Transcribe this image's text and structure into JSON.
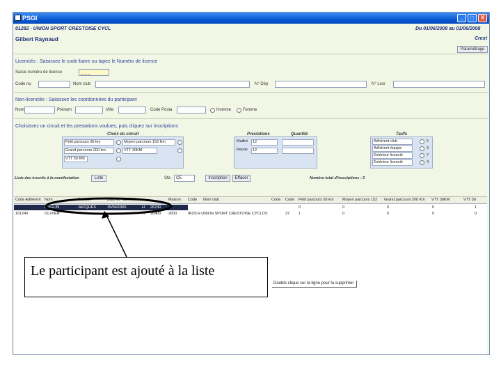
{
  "window": {
    "title": "PSGI",
    "controls": {
      "minimize": "_",
      "maximize": "□",
      "close": "X"
    }
  },
  "header": {
    "club": "01282 - UNION SPORT CRESTOISE CYCL",
    "person": "Gilbert Raynaud",
    "period": "Du 01/06/2008 au 01/06/2008",
    "place": "Crest",
    "settings_button": "Paramétrage"
  },
  "licencies": {
    "section_title": "Licenciés : Saisissez le code-barre ou tapez le Numéro de licence",
    "barcode_label": "Saisie numéro de licence",
    "barcode_value": "_ _ _",
    "fields": [
      {
        "label": "Code nu",
        "value": ""
      },
      {
        "label": "Nom club",
        "value": ""
      },
      {
        "label": "N° Dép",
        "value": ""
      },
      {
        "label": "N° Lice",
        "value": ""
      }
    ]
  },
  "non_licencies": {
    "section_title": "Non-licenciés : Saisissez les coordonnées du participant",
    "fields": [
      {
        "label": "Nom",
        "value": ""
      },
      {
        "label": "Prénom",
        "value": ""
      },
      {
        "label": "Ville",
        "value": ""
      },
      {
        "label": "Code Posta",
        "value": ""
      }
    ],
    "gender": {
      "male": "Homme",
      "female": "Femme"
    }
  },
  "circuit": {
    "section_title": "Choisissez un circuit et les prestations voulues, puis cliquez sur inscriptions",
    "col_circuit": "Choix du circuit",
    "col_prestations": "Prestations",
    "col_quantite": "Quantité",
    "col_tarifs": "Tarifs",
    "circuits": [
      {
        "label": "Petit parcours 95 km",
        "value": ""
      },
      {
        "label": "Grand parcours 200 km",
        "value": ""
      },
      {
        "label": "VTT 50 KM",
        "value": ""
      }
    ],
    "circuits_right": [
      {
        "label": "Moyen parcours 152 Km"
      },
      {
        "label": "VTT 30KM"
      }
    ],
    "prestations": [
      {
        "label": "Maillot",
        "value": "12"
      },
      {
        "label": "Repas",
        "value": "12"
      }
    ],
    "tarifs": [
      {
        "label": "Adhérent club",
        "value": "5"
      },
      {
        "label": "Adhérent équipe",
        "value": "3"
      },
      {
        "label": "Extérieur licencié",
        "value": "7"
      },
      {
        "label": "Extérieur licencié jeune",
        "value": "4"
      }
    ]
  },
  "listing": {
    "label": "Liste des inscrits à la manifestation",
    "list_button": "Liste",
    "sta_label": "Sta",
    "sta_value": "CE",
    "inscription_button": "Inscription",
    "delete_button": "Effacer",
    "total_label": "Nombre total d'inscriptions : 2"
  },
  "table": {
    "columns": [
      "Code Adhérent",
      "Nom",
      "Prénom",
      "Date de naissance",
      "Maison",
      "Code",
      "Nom club",
      "Code",
      "Code",
      "Petit parcours 95 km",
      "Moyen parcours 152",
      "Grand parcours 200 Km",
      "VTT 30KM",
      "VTT 50"
    ],
    "rows": [
      [
        "",
        "MAGLIN",
        "JACQUES",
        "15/04/1965",
        "H",
        "26740",
        "",
        "",
        "",
        "0",
        "0",
        "0",
        "0",
        "1"
      ],
      [
        "161240",
        "OLIVIER",
        "",
        "",
        "H",
        "26400",
        "2600",
        "IROCH UNION SPORT CRESTOISE CYCLOS",
        "37",
        "1",
        "0",
        "0",
        "0",
        "0"
      ]
    ]
  },
  "callout": {
    "text": "Le participant est ajouté à la liste"
  },
  "hint": {
    "text": "Double clique sur la ligne pour la supprimer"
  }
}
